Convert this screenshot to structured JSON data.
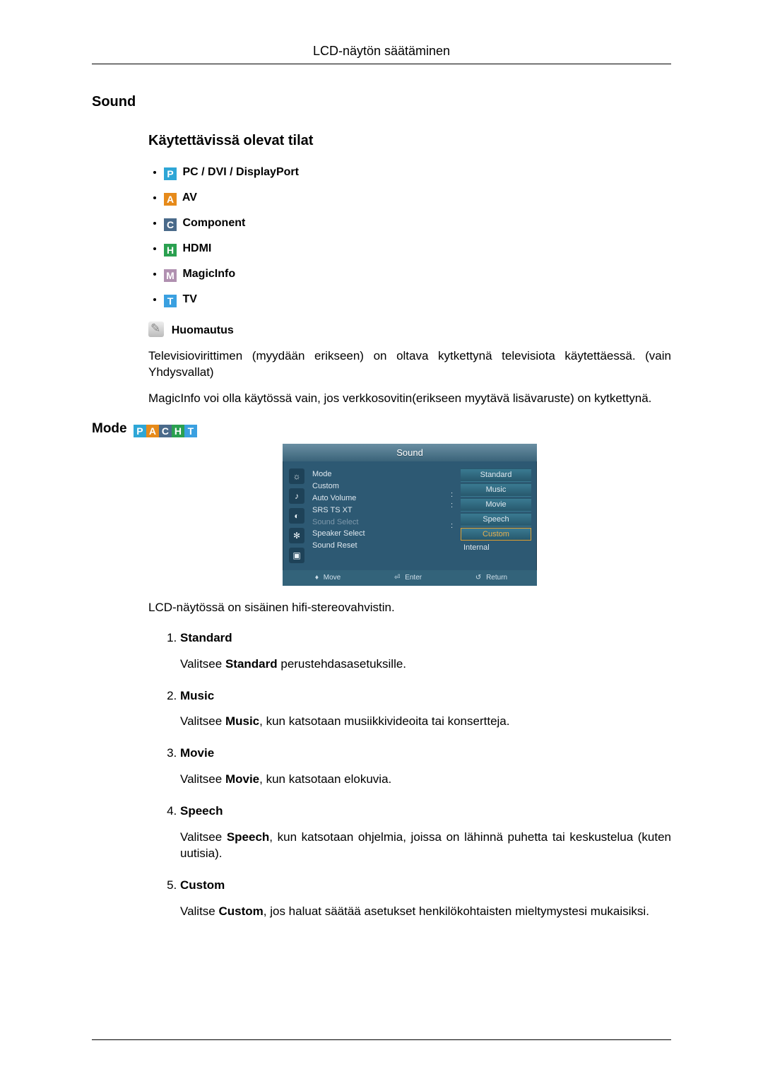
{
  "header": {
    "title": "LCD-näytön säätäminen"
  },
  "sound": {
    "title": "Sound",
    "modes_title": "Käytettävissä olevat tilat",
    "modes": [
      {
        "letter": "P",
        "cls": "ic-P",
        "label": "PC / DVI / DisplayPort"
      },
      {
        "letter": "A",
        "cls": "ic-A",
        "label": "AV"
      },
      {
        "letter": "C",
        "cls": "ic-C",
        "label": "Component"
      },
      {
        "letter": "H",
        "cls": "ic-H",
        "label": "HDMI"
      },
      {
        "letter": "M",
        "cls": "ic-M",
        "label": "MagicInfo"
      },
      {
        "letter": "T",
        "cls": "ic-T",
        "label": "TV"
      }
    ],
    "note_label": "Huomautus",
    "note_p1": "Televisiovirittimen (myydään erikseen) on oltava kytkettynä televisiota käytettäessä. (vain Yhdysvallat)",
    "note_p2": "MagicInfo voi olla käytössä vain, jos verkkosovitin(erikseen myytävä lisävaruste) on kytkettynä."
  },
  "mode": {
    "title": "Mode",
    "badge_letters": [
      "P",
      "A",
      "C",
      "H",
      "T"
    ],
    "badge_classes": [
      "ic-P",
      "ic-A",
      "ic-C",
      "ic-H",
      "ic-T"
    ]
  },
  "osd": {
    "title": "Sound",
    "menu_items": [
      "Mode",
      "Custom",
      "Auto Volume",
      "SRS TS XT",
      "Sound Select",
      "Speaker Select",
      "Sound Reset"
    ],
    "mode_options": [
      "Standard",
      "Music",
      "Movie",
      "Speech",
      "Custom"
    ],
    "selected_index": 4,
    "speaker_value": "Internal",
    "footer": {
      "move": "Move",
      "enter": "Enter",
      "return": "Return"
    }
  },
  "desc": {
    "intro": "LCD-näytössä on sisäinen hifi-stereovahvistin.",
    "items": [
      {
        "title": "Standard",
        "text_before": "Valitsee ",
        "bold": "Standard",
        "text_after": " perustehdasasetuksille."
      },
      {
        "title": "Music",
        "text_before": "Valitsee ",
        "bold": "Music",
        "text_after": ", kun katsotaan musiikkivideoita tai konsertteja."
      },
      {
        "title": "Movie",
        "text_before": "Valitsee ",
        "bold": "Movie",
        "text_after": ", kun katsotaan elokuvia."
      },
      {
        "title": "Speech",
        "text_before": "Valitsee ",
        "bold": "Speech",
        "text_after": ", kun katsotaan ohjelmia, joissa on lähinnä puhetta tai keskustelua (kuten uutisia)."
      },
      {
        "title": "Custom",
        "text_before": "Valitse ",
        "bold": "Custom",
        "text_after": ", jos haluat säätää asetukset henkilökohtaisten mieltymystesi mukaisiksi."
      }
    ]
  }
}
